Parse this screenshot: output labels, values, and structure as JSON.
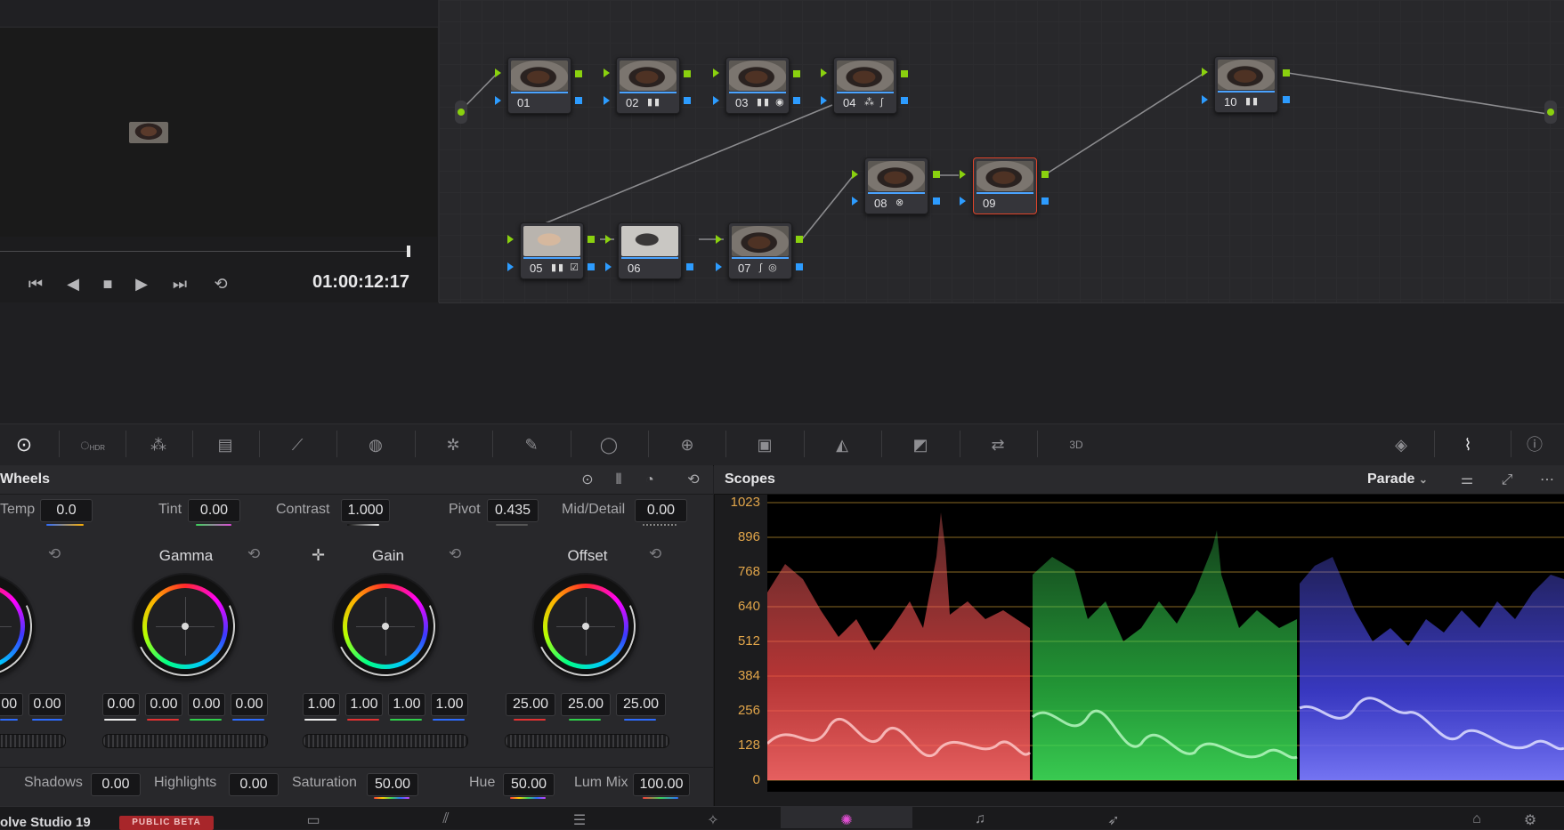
{
  "viewer": {
    "timecode": "01:00:12:17",
    "transport": [
      "skip-back-icon",
      "step-back-icon",
      "stop-icon",
      "play-icon",
      "skip-forward-icon",
      "loop-icon"
    ]
  },
  "node_editor": {
    "nodes": [
      {
        "id": "01",
        "tools": ""
      },
      {
        "id": "02",
        "tools": "▮▮"
      },
      {
        "id": "03",
        "tools": "▮▮ ◉"
      },
      {
        "id": "04",
        "tools": "⁂ ∫"
      },
      {
        "id": "05",
        "tools": "▮▮ ☑"
      },
      {
        "id": "06",
        "tools": ""
      },
      {
        "id": "07",
        "tools": "∫ ◎"
      },
      {
        "id": "08",
        "tools": "⊗"
      },
      {
        "id": "09",
        "tools": ""
      },
      {
        "id": "10",
        "tools": "▮▮"
      }
    ],
    "selected_node": "09"
  },
  "palette": {
    "icons": [
      "primaries-wheels-icon",
      "hdr-icon",
      "rgb-mixer-icon",
      "motion-effects-icon",
      "curves-icon",
      "color-warper-icon",
      "qualifier-icon",
      "window-icon",
      "tracker-icon",
      "magic-mask-icon",
      "blur-icon",
      "key-icon",
      "sizing-icon",
      "3d-icon",
      "keyframes-icon",
      "scopes-icon",
      "info-icon"
    ],
    "hdr_label": "HDR",
    "label_3d": "3D"
  },
  "wheels": {
    "title": "Wheels",
    "params_top": {
      "temp": {
        "label": "Temp",
        "value": "0.0"
      },
      "tint": {
        "label": "Tint",
        "value": "0.00"
      },
      "contrast": {
        "label": "Contrast",
        "value": "1.000"
      },
      "pivot": {
        "label": "Pivot",
        "value": "0.435"
      },
      "middetail": {
        "label": "Mid/Detail",
        "value": "0.00"
      }
    },
    "lift_values": [
      ".00",
      "0.00"
    ],
    "gamma": {
      "title": "Gamma",
      "values": [
        "0.00",
        "0.00",
        "0.00",
        "0.00"
      ]
    },
    "gain": {
      "title": "Gain",
      "values": [
        "1.00",
        "1.00",
        "1.00",
        "1.00"
      ]
    },
    "offset": {
      "title": "Offset",
      "values": [
        "25.00",
        "25.00",
        "25.00"
      ]
    },
    "params_bottom": {
      "shadows": {
        "label": "Shadows",
        "value": "0.00"
      },
      "highlights": {
        "label": "Highlights",
        "value": "0.00"
      },
      "saturation": {
        "label": "Saturation",
        "value": "50.00"
      },
      "hue": {
        "label": "Hue",
        "value": "50.00"
      },
      "lummix": {
        "label": "Lum Mix",
        "value": "100.00"
      }
    }
  },
  "scopes": {
    "title": "Scopes",
    "mode": "Parade",
    "yticks": [
      "1023",
      "896",
      "768",
      "640",
      "512",
      "384",
      "256",
      "128",
      "0"
    ],
    "colors": {
      "red": "#ff5a5a",
      "green": "#3fe05a",
      "blue": "#5a5aff",
      "grid": "#b98a2e"
    }
  },
  "bottom": {
    "app_name": "olve Studio 19",
    "beta": "PUBLIC BETA",
    "pages": [
      "media-icon",
      "cut-icon",
      "edit-icon",
      "fusion-icon",
      "color-icon",
      "fairlight-icon",
      "deliver-icon"
    ],
    "right": [
      "home-icon",
      "settings-icon"
    ]
  }
}
